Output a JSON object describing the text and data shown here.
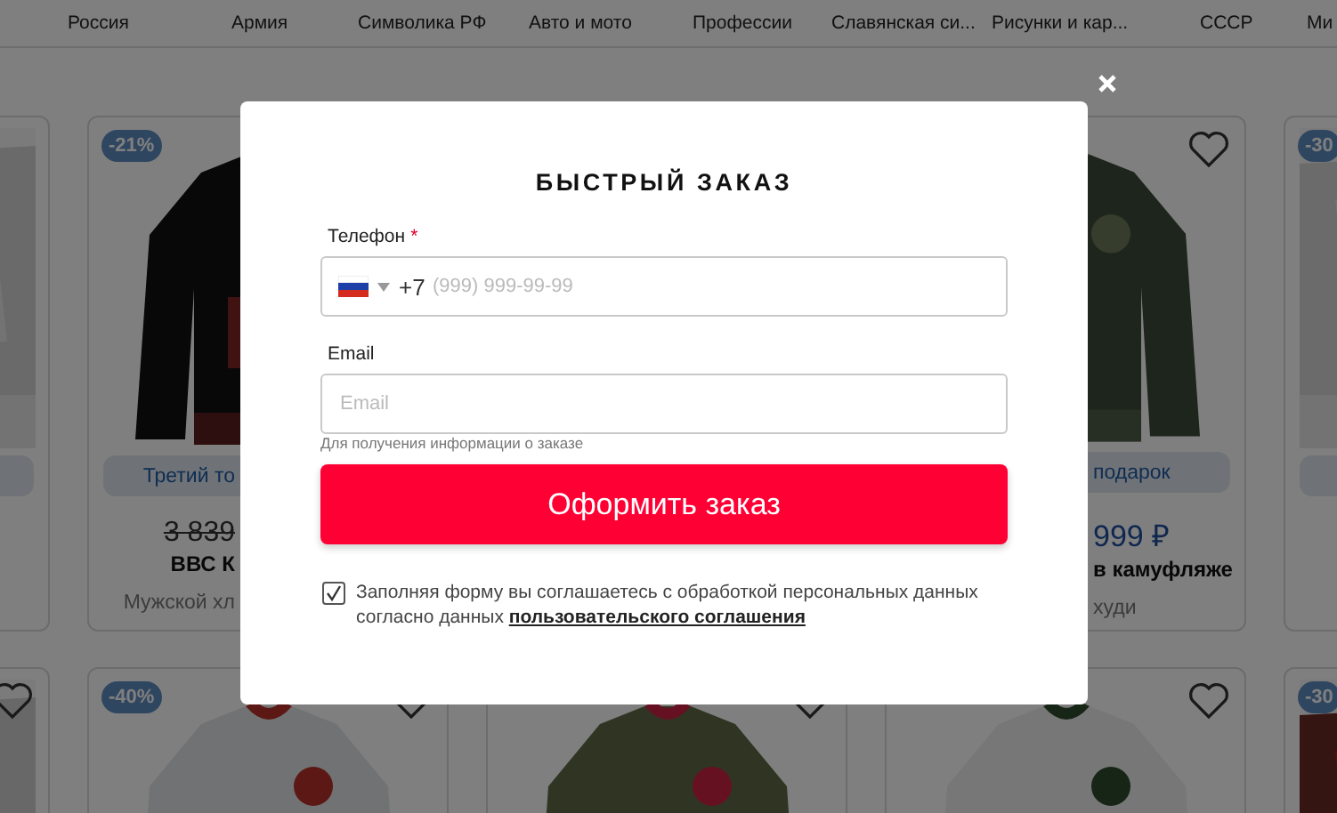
{
  "nav": {
    "items": [
      "Россия",
      "Армия",
      "Символика РФ",
      "Авто и мото",
      "Профессии",
      "Славянская си...",
      "Рисунки и кар...",
      "СССР",
      "Ми"
    ]
  },
  "products": [
    [
      {
        "promo": true
      },
      {
        "badge": "-21%",
        "pill": "Третий то",
        "old_price": "3 839",
        "name": "ВВС К",
        "subtitle": "Мужской хл"
      },
      {
        "favorite": false,
        "pill": "подарок",
        "price": "999 ₽",
        "name": "в камуфляже",
        "subtitle": "худи"
      },
      {
        "badge": "-30",
        "promo": true
      }
    ],
    [
      {
        "favorite": false
      },
      {
        "badge": "-40%",
        "favorite": false
      },
      {
        "favorite": false
      },
      {
        "favorite": false
      },
      {
        "badge": "-30"
      }
    ]
  ],
  "modal": {
    "title": "БЫСТРЫЙ ЗАКАЗ",
    "fields": [
      {
        "kind": "phone",
        "label": "Телефон",
        "required_mark": "*",
        "code": "+7",
        "placeholder": "(999) 999-99-99"
      },
      {
        "kind": "email",
        "label": "Email",
        "placeholder": "Email",
        "hint": "Для получения информации о заказе"
      }
    ],
    "submit": "Оформить заказ",
    "consent": {
      "checked": true,
      "text": "Заполняя форму вы соглашаетесь с обработкой персональных данных согласно данных ",
      "link": "пользовательского соглашения"
    }
  }
}
